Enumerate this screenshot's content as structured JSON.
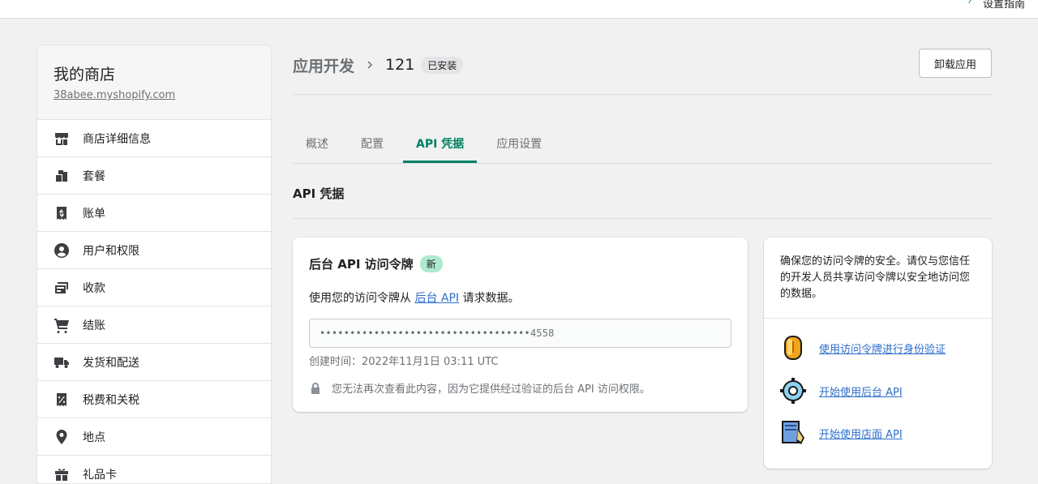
{
  "topbar": {
    "guide_label": "设置指南"
  },
  "store": {
    "name": "我的商店",
    "domain": "38abee.myshopify.com"
  },
  "sidebar": {
    "items": [
      {
        "label": "商店详细信息",
        "icon": "store-icon"
      },
      {
        "label": "套餐",
        "icon": "plan-icon"
      },
      {
        "label": "账单",
        "icon": "billing-icon"
      },
      {
        "label": "用户和权限",
        "icon": "user-icon"
      },
      {
        "label": "收款",
        "icon": "payments-icon"
      },
      {
        "label": "结账",
        "icon": "cart-icon"
      },
      {
        "label": "发货和配送",
        "icon": "truck-icon"
      },
      {
        "label": "税费和关税",
        "icon": "tax-icon"
      },
      {
        "label": "地点",
        "icon": "location-icon"
      },
      {
        "label": "礼品卡",
        "icon": "gift-icon"
      }
    ]
  },
  "header": {
    "parent": "应用开发",
    "title": "121",
    "status_badge": "已安装",
    "uninstall_label": "卸载应用"
  },
  "tabs": [
    {
      "label": "概述",
      "active": false
    },
    {
      "label": "配置",
      "active": false
    },
    {
      "label": "API 凭据",
      "active": true
    },
    {
      "label": "应用设置",
      "active": false
    }
  ],
  "section": {
    "title": "API 凭据"
  },
  "admin_token": {
    "title": "后台 API 访问令牌",
    "new_badge": "新",
    "desc_before": "使用您的访问令牌从 ",
    "desc_link": "后台 API",
    "desc_after": " 请求数据。",
    "token_masked": "•••••••••••••••••••••••••••••••••••4558",
    "created": "创建时间：2022年11月1日 03:11 UTC",
    "warning": "您无法再次查看此内容，因为它提供经过验证的后台 API 访问权限。"
  },
  "side_card": {
    "message": "确保您的访问令牌的安全。请仅与您信任的开发人员共享访问令牌以安全地访问您的数据。",
    "links": [
      {
        "label": "使用访问令牌进行身份验证",
        "icon": "coin-icon"
      },
      {
        "label": "开始使用后台 API",
        "icon": "gear-icon"
      },
      {
        "label": "开始使用店面 API",
        "icon": "blueprint-icon"
      }
    ]
  },
  "colors": {
    "accent": "#008060",
    "link": "#2c6ecb",
    "new_badge": "#aee9d1"
  }
}
